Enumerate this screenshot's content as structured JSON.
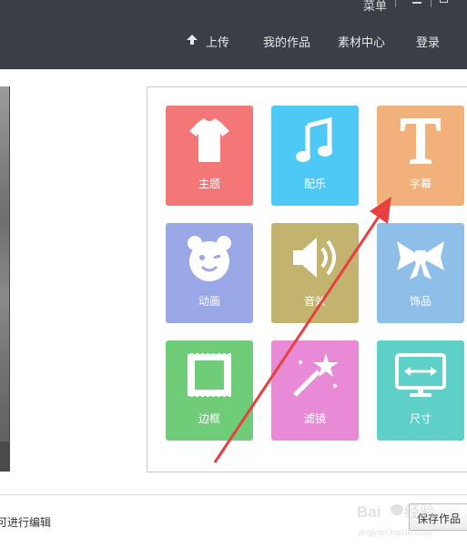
{
  "header": {
    "menu_label": "菜单",
    "nav": {
      "upload": "上传",
      "my_works": "我的作品",
      "materials": "素材中心",
      "login": "登录"
    }
  },
  "tools": [
    {
      "label": "主题",
      "color": "#f47777",
      "icon": "tshirt-icon"
    },
    {
      "label": "配乐",
      "color": "#4ec8f4",
      "icon": "music-note-icon"
    },
    {
      "label": "字幕",
      "color": "#f2b07a",
      "icon": "text-T-icon"
    },
    {
      "label": "动画",
      "color": "#9aa8e8",
      "icon": "bear-face-icon"
    },
    {
      "label": "音效",
      "color": "#c2b36f",
      "icon": "speaker-icon"
    },
    {
      "label": "饰品",
      "color": "#8ebfe8",
      "icon": "bow-icon"
    },
    {
      "label": "边框",
      "color": "#6fcd7a",
      "icon": "frame-icon"
    },
    {
      "label": "滤镜",
      "color": "#e88ad6",
      "icon": "magic-wand-icon"
    },
    {
      "label": "尺寸",
      "color": "#5ed0c8",
      "icon": "monitor-resize-icon"
    }
  ],
  "footer": {
    "hint": "可进行编辑",
    "save": "保存作品"
  },
  "annotation": {
    "color": "#e84040"
  }
}
